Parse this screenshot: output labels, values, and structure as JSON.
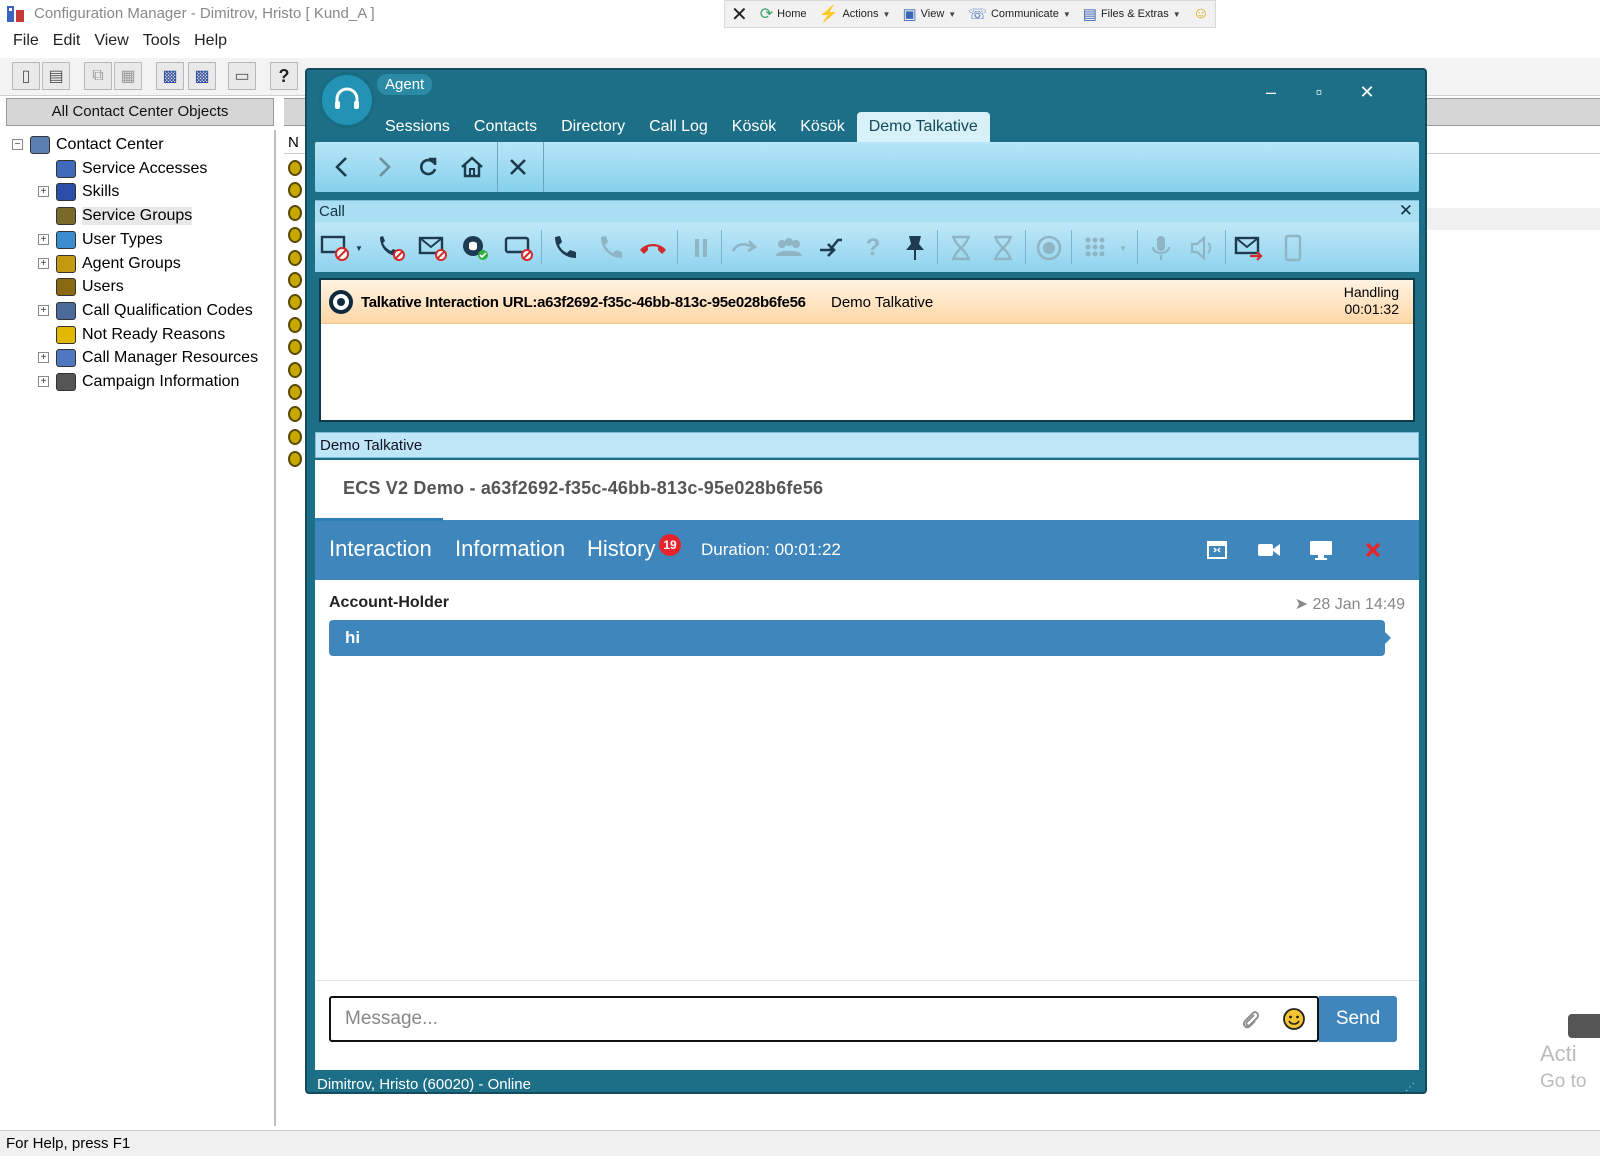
{
  "background_app": {
    "title": "Configuration Manager - Dimitrov, Hristo  [ Kund_A ]",
    "quickbar": {
      "close_label": "✕",
      "items": [
        {
          "label": "Home",
          "icon": "home-icon"
        },
        {
          "label": "Actions",
          "icon": "lightning-icon"
        },
        {
          "label": "View",
          "icon": "view-icon"
        },
        {
          "label": "Communicate",
          "icon": "phone-icon"
        },
        {
          "label": "Files & Extras",
          "icon": "files-icon"
        }
      ],
      "smiley": "☺"
    },
    "menu": [
      "File",
      "Edit",
      "View",
      "Tools",
      "Help"
    ],
    "tree_header": "All Contact Center Objects",
    "tree": [
      {
        "label": "Contact Center",
        "expandable": "minus",
        "level": 0
      },
      {
        "label": "Service Accesses",
        "expandable": "",
        "level": 1
      },
      {
        "label": "Skills",
        "expandable": "plus",
        "level": 1
      },
      {
        "label": "Service Groups",
        "expandable": "",
        "level": 1,
        "selected": true
      },
      {
        "label": "User Types",
        "expandable": "plus",
        "level": 1
      },
      {
        "label": "Agent Groups",
        "expandable": "plus",
        "level": 1
      },
      {
        "label": "Users",
        "expandable": "",
        "level": 1
      },
      {
        "label": "Call Qualification Codes",
        "expandable": "plus",
        "level": 1
      },
      {
        "label": "Not Ready Reasons",
        "expandable": "",
        "level": 1
      },
      {
        "label": "Call Manager Resources",
        "expandable": "plus",
        "level": 1
      },
      {
        "label": "Campaign Information",
        "expandable": "plus",
        "level": 1
      }
    ],
    "list_column": "N",
    "status": "For Help, press F1",
    "watermark": [
      "Acti",
      "Go to"
    ]
  },
  "agent": {
    "title": "Agent",
    "window_controls": {
      "minimize": "–",
      "maximize": "▫",
      "close": "✕"
    },
    "tabs": [
      {
        "label": "Sessions",
        "active": false
      },
      {
        "label": "Contacts",
        "active": false
      },
      {
        "label": "Directory",
        "active": false
      },
      {
        "label": "Call Log",
        "active": false
      },
      {
        "label": "Kösök",
        "active": false
      },
      {
        "label": "Kösök",
        "active": false
      },
      {
        "label": "Demo Talkative",
        "active": true
      }
    ],
    "call_panel": {
      "header": "Call",
      "close": "✕",
      "interaction_url": "Talkative Interaction URL:a63f2692-f35c-46bb-813c-95e028b6fe56",
      "service": "Demo Talkative",
      "state": "Handling",
      "timer": "00:01:32"
    },
    "talkative": {
      "header": "Demo Talkative",
      "title": "ECS V2 Demo - a63f2692-f35c-46bb-813c-95e028b6fe56",
      "tabs": {
        "interaction": "Interaction",
        "information": "Information",
        "history": "History"
      },
      "history_count": "19",
      "duration": "Duration: 00:01:22",
      "message": {
        "sender": "Account-Holder",
        "time": "28 Jan 14:49",
        "text": "hi"
      },
      "composer": {
        "placeholder": "Message...",
        "send": "Send"
      }
    },
    "status": "Dimitrov, Hristo (60020)  - Online"
  }
}
